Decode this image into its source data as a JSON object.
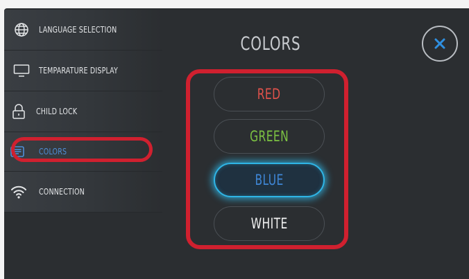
{
  "sidebar": {
    "items": [
      {
        "label": "LANGUAGE SELECTION",
        "icon": "globe-icon"
      },
      {
        "label": "TEMPARATURE DISPLAY",
        "icon": "monitor-icon"
      },
      {
        "label": "CHILD LOCK",
        "icon": "lock-icon"
      },
      {
        "label": "COLORS",
        "icon": "list-icon",
        "active": true
      },
      {
        "label": "CONNECTION",
        "icon": "wifi-icon"
      }
    ]
  },
  "main": {
    "title": "COLORS",
    "options": [
      {
        "label": "RED",
        "color": "#e0524b"
      },
      {
        "label": "GREEN",
        "color": "#7cc243"
      },
      {
        "label": "BLUE",
        "color": "#3f86d6",
        "selected": true
      },
      {
        "label": "WHITE",
        "color": "#f2f2f2"
      }
    ]
  },
  "close_icon": "close-icon",
  "colors": {
    "background": "#2b2e31",
    "accent": "#2fb5e6",
    "highlight": "#d0202f",
    "active_text": "#4f8fd8"
  }
}
